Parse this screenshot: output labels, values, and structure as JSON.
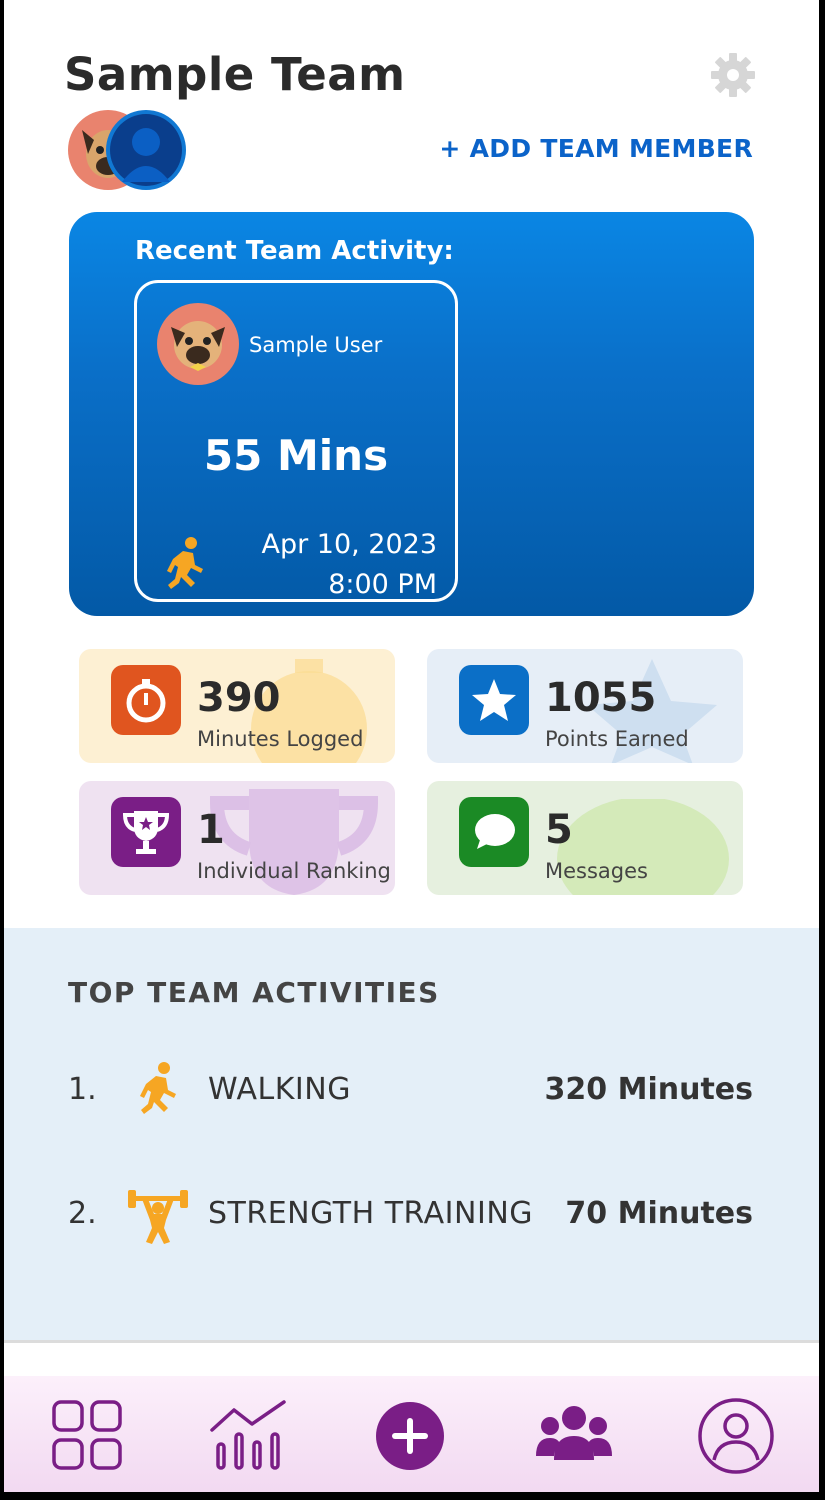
{
  "header": {
    "title": "Sample Team",
    "add_member_label": "+ ADD TEAM MEMBER"
  },
  "recent_activity": {
    "heading": "Recent Team Activity:",
    "user_name": "Sample User",
    "minutes": "55 Mins",
    "date": "Apr 10, 2023",
    "time": "8:00 PM",
    "activity_icon": "running-icon"
  },
  "stats": [
    {
      "value": "390",
      "label": "Minutes Logged",
      "icon": "stopwatch-icon",
      "color": "#e0551f"
    },
    {
      "value": "1055",
      "label": "Points Earned",
      "icon": "star-icon",
      "color": "#0b6fc7"
    },
    {
      "value": "1",
      "label": "Individual Ranking",
      "icon": "trophy-icon",
      "color": "#7a1e86"
    },
    {
      "value": "5",
      "label": "Messages",
      "icon": "chat-icon",
      "color": "#1b8a25"
    }
  ],
  "top_activities": {
    "title": "TOP TEAM ACTIVITIES",
    "items": [
      {
        "rank": "1.",
        "name": "WALKING",
        "value": "320 Minutes",
        "icon": "walking-icon"
      },
      {
        "rank": "2.",
        "name": "STRENGTH TRAINING",
        "value": "70 Minutes",
        "icon": "weightlifting-icon"
      }
    ]
  },
  "nav": {
    "items": [
      "dashboard-icon",
      "stats-icon",
      "add-icon",
      "team-icon",
      "profile-icon"
    ],
    "active_color": "#7a1e86"
  }
}
